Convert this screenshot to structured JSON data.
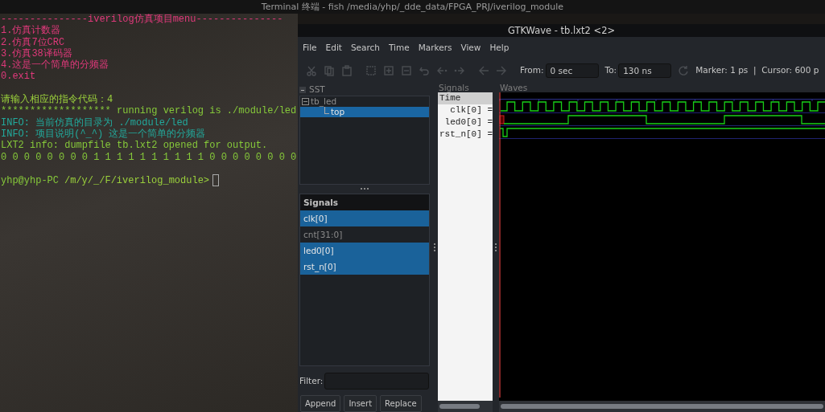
{
  "terminal": {
    "title": "Terminal 终端 - fish /media/yhp/_dde_data/FPGA_PRJ/iverilog_module",
    "blocks": [
      [
        {
          "kind": "menu",
          "text": "---------------iverilog仿真项目menu---------------"
        },
        {
          "kind": "menu",
          "text": "1.仿真计数器"
        },
        {
          "kind": "menu",
          "text": "2.仿真7位CRC"
        },
        {
          "kind": "menu",
          "text": "3.仿真38译码器"
        },
        {
          "kind": "menu",
          "text": "4.这是一个简单的分频器"
        },
        {
          "kind": "menu",
          "text": "0.exit"
        }
      ],
      [
        {
          "kind": "input",
          "text": "请输入相应的指令代码：4"
        },
        {
          "kind": "output",
          "text": "******************* running verilog is ./module/led"
        },
        {
          "kind": "info",
          "text": "INFO: 当前仿真的目录为 ./module/led"
        },
        {
          "kind": "info",
          "text": "INFO: 项目说明(^_^) 这是一个简单的分频器"
        },
        {
          "kind": "output",
          "text": "LXT2 info: dumpfile tb.lxt2 opened for output."
        },
        {
          "kind": "output",
          "text": "0 0 0 0 0 0 0 0 1 1 1 1 1 1 1 1 1 1 0 0 0 0 0 0 0 0"
        }
      ]
    ],
    "prompt": {
      "host": "yhp@yhp-PC",
      "path": "/m/y/_/F/iverilog_module>"
    }
  },
  "gtkwave": {
    "title": "GTKWave - tb.lxt2 <2>",
    "menu": [
      "File",
      "Edit",
      "Search",
      "Time",
      "Markers",
      "View",
      "Help"
    ],
    "from_label": "From:",
    "from_value": "0 sec",
    "to_label": "To:",
    "to_value": "130 ns",
    "status": "Marker: 1 ps  |  Cursor: 600 p",
    "sst": {
      "title": "SST",
      "tree": [
        {
          "label": "tb_led",
          "expanded": true,
          "selected": false,
          "children": [
            {
              "label": "top",
              "selected": true
            }
          ]
        }
      ],
      "signals_title": "Signals",
      "signals": [
        {
          "label": "clk[0]",
          "selected": true
        },
        {
          "label": "cnt[31:0]",
          "selected": false
        },
        {
          "label": "led0[0]",
          "selected": true
        },
        {
          "label": "rst_n[0]",
          "selected": true
        }
      ],
      "filter_label": "Filter:",
      "buttons": [
        "Append",
        "Insert",
        "Replace"
      ]
    },
    "signals_pane": {
      "title": "Signals",
      "header": "Time",
      "rows": [
        "clk[0] =",
        "led0[0] =",
        "rst_n[0] ="
      ]
    },
    "waves": {
      "title": "Waves"
    }
  }
}
